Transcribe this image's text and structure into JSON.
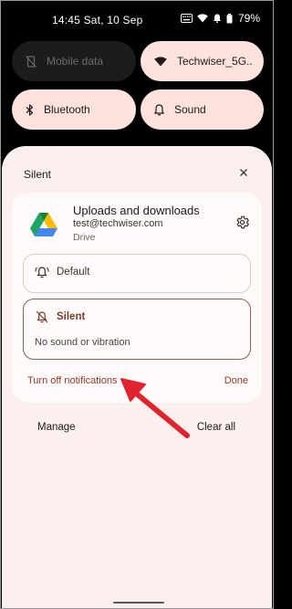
{
  "status_bar": {
    "time": "14:45",
    "date": "Sat, 10 Sep",
    "battery": "79%",
    "icons": [
      "keyboard-icon",
      "wifi-icon",
      "do-not-disturb-icon",
      "battery-icon"
    ]
  },
  "quick_tiles": [
    {
      "label": "Mobile data",
      "icon": "mobile-data-off-icon",
      "active": false
    },
    {
      "label": "Techwiser_5G..",
      "icon": "wifi-icon",
      "active": true
    },
    {
      "label": "Bluetooth",
      "icon": "bluetooth-icon",
      "active": true
    },
    {
      "label": "Sound",
      "icon": "bell-icon",
      "active": true
    }
  ],
  "sheet": {
    "title": "Silent",
    "card": {
      "app_name": "Uploads and downloads",
      "account": "test@techwiser.com",
      "app_label": "Drive",
      "options": {
        "default_label": "Default",
        "silent_label": "Silent",
        "silent_description": "No sound or vibration",
        "selected": "silent"
      },
      "turn_off_label": "Turn off notifications",
      "done_label": "Done"
    },
    "manage_label": "Manage",
    "clear_all_label": "Clear all"
  },
  "colors": {
    "accent": "#8b3b28",
    "annotation_arrow": "#e0232e",
    "tile_active": "#fde2dd",
    "sheet_bg": "#fbf0ee"
  }
}
